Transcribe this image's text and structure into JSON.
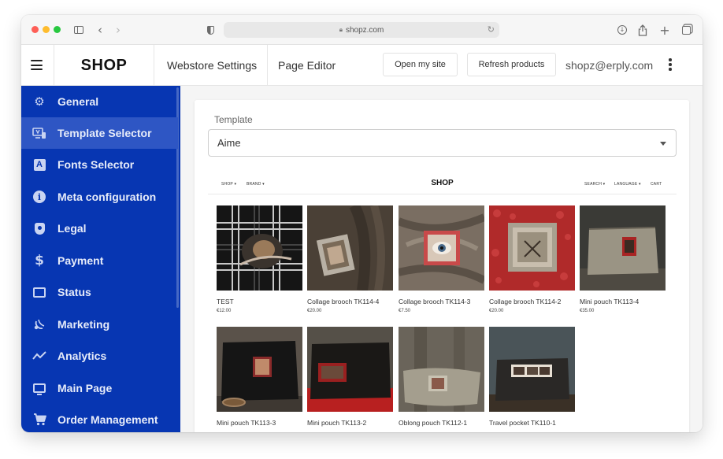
{
  "browser": {
    "url": "shopz.com"
  },
  "header": {
    "logo": "SHOP",
    "nav": {
      "webstore_settings": "Webstore Settings",
      "page_editor": "Page Editor"
    },
    "open_site_label": "Open my site",
    "refresh_label": "Refresh products",
    "user_email": "shopz@erply.com"
  },
  "sidebar": {
    "items": [
      {
        "label": "General",
        "icon": "gear-icon"
      },
      {
        "label": "Template Selector",
        "icon": "template-icon",
        "active": true
      },
      {
        "label": "Fonts Selector",
        "icon": "font-icon"
      },
      {
        "label": "Meta configuration",
        "icon": "info-icon"
      },
      {
        "label": "Legal",
        "icon": "shield-icon"
      },
      {
        "label": "Payment",
        "icon": "dollar-icon"
      },
      {
        "label": "Status",
        "icon": "chat-icon"
      },
      {
        "label": "Marketing",
        "icon": "broadcast-icon"
      },
      {
        "label": "Analytics",
        "icon": "trend-icon"
      },
      {
        "label": "Main Page",
        "icon": "monitor-icon"
      },
      {
        "label": "Order Management",
        "icon": "cart-icon"
      }
    ]
  },
  "template": {
    "label": "Template",
    "selected": "Aime"
  },
  "preview": {
    "logo": "SHOP",
    "nav_left": [
      "SHOP ▾",
      "BRAND ▾"
    ],
    "nav_right": [
      "SEARCH ▾",
      "LANGUAGE ▾",
      "CART"
    ],
    "products": [
      {
        "name": "TEST",
        "price": "€12.00"
      },
      {
        "name": "Collage brooch TK114-4",
        "price": "€20.00"
      },
      {
        "name": "Collage brooch TK114-3",
        "price": "€7.50"
      },
      {
        "name": "Collage brooch TK114-2",
        "price": "€20.00"
      },
      {
        "name": "Mini pouch TK113-4",
        "price": "€35.00"
      },
      {
        "name": "Mini pouch TK113-3",
        "price": ""
      },
      {
        "name": "Mini pouch TK113-2",
        "price": ""
      },
      {
        "name": "Oblong pouch TK112-1",
        "price": ""
      },
      {
        "name": "Travel pocket TK110-1",
        "price": ""
      }
    ]
  },
  "colors": {
    "sidebar_bg": "#0736b2",
    "sidebar_active": "#2e56c4"
  }
}
